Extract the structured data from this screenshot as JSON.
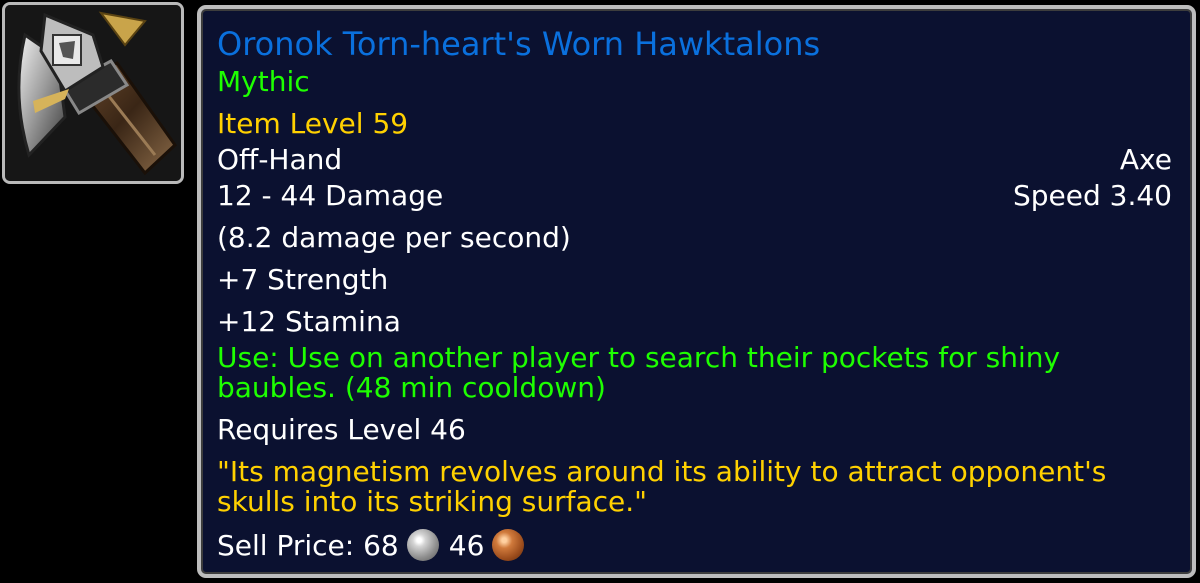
{
  "item": {
    "name": "Oronok Torn-heart's Worn Hawktalons",
    "quality": "Mythic",
    "item_level": "Item Level 59",
    "slot": "Off-Hand",
    "type": "Axe",
    "damage": "12 - 44 Damage",
    "speed": "Speed 3.40",
    "dps": "(8.2 damage per second)",
    "stats": [
      "+7 Strength",
      "+12 Stamina"
    ],
    "use_effect": "Use: Use on another player to search their pockets for shiny baubles. (48 min cooldown)",
    "requirement": "Requires Level 46",
    "flavor_text": "\"Its magnetism revolves around its ability to attract opponent's skulls into its striking surface.\"",
    "sell_price": {
      "label": "Sell Price:",
      "silver": "68",
      "copper": "46"
    },
    "icon": "axe-icon"
  },
  "colors": {
    "name": "#0a70dd",
    "quality": "#1eff00",
    "item_level": "#ffd100",
    "use_effect": "#1eff00",
    "flavor_text": "#ffd100",
    "text": "#ffffff",
    "background": "#0b1130",
    "border": "#bdbdbd"
  }
}
